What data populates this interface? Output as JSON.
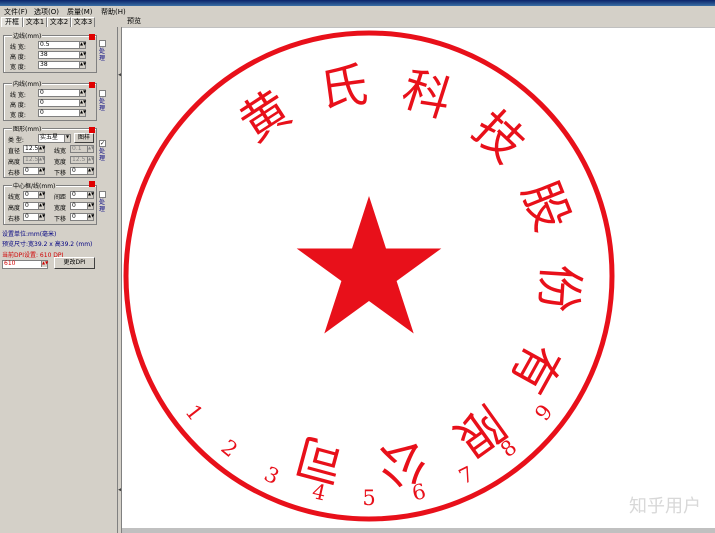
{
  "menu": [
    "文件(F)",
    "选项(O)",
    "质量(M)",
    "帮助(H)"
  ],
  "tabs": [
    "开框",
    "文本1",
    "文本2",
    "文本3"
  ],
  "preview_label": "预览",
  "border_group": {
    "title": "边线(mm)",
    "rows": [
      {
        "label": "线  宽:",
        "value": "0.5"
      },
      {
        "label": "高  度:",
        "value": "38"
      },
      {
        "label": "宽  度:",
        "value": "38"
      }
    ],
    "check_label": "处理"
  },
  "inner_group": {
    "title": "内线(mm)",
    "rows": [
      {
        "label": "线  宽:",
        "value": "0"
      },
      {
        "label": "高  度:",
        "value": "0"
      },
      {
        "label": "宽  度:",
        "value": "0"
      }
    ],
    "check_label": "处理"
  },
  "pattern_group": {
    "title": "图形(mm)",
    "type_label": "类  型:",
    "type_value": "实五星",
    "pattern_button": "图样",
    "rows": [
      {
        "l1": "直径",
        "v1": "12.5",
        "l2": "线宽",
        "v2": "0.1"
      },
      {
        "l1": "高度",
        "v1": "12.5",
        "l2": "宽度",
        "v2": "12.5"
      },
      {
        "l1": "右移",
        "v1": "0",
        "l2": "下移",
        "v2": "0"
      }
    ],
    "check_label": "处理"
  },
  "center_group": {
    "title": "中心框/线(mm)",
    "rows": [
      {
        "l1": "线宽",
        "v1": "0",
        "l2": "间距",
        "v2": "0"
      },
      {
        "l1": "高度",
        "v1": "0",
        "l2": "宽度",
        "v2": "0"
      },
      {
        "l1": "右移",
        "v1": "0",
        "l2": "下移",
        "v2": "0"
      }
    ],
    "check_label": "处理"
  },
  "status": {
    "unit": "设置单位:mm(毫米)",
    "preview_size": "预览尺寸:宽39.2 x 高39.2 (mm)",
    "dpi_text": "当前DPI设置: 610 DPI",
    "dpi_value": "610",
    "change_dpi_button": "更改DPI"
  },
  "seal": {
    "company_chars": [
      "黄",
      "氏",
      "科",
      "技",
      "股",
      "份",
      "有",
      "限",
      "公",
      "司"
    ],
    "serial_digits": [
      "1",
      "2",
      "3",
      "4",
      "5",
      "6",
      "7",
      "8",
      "9"
    ],
    "color": "#e8101a"
  },
  "watermark": "知乎用户"
}
